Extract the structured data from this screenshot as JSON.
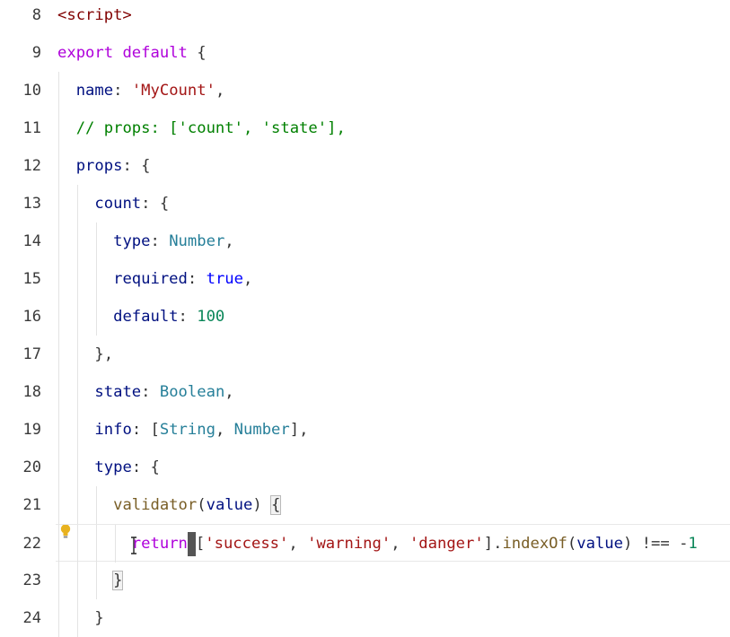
{
  "editor": {
    "lines": [
      {
        "num": "8",
        "tokens": [
          [
            "<script>",
            "tag"
          ]
        ]
      },
      {
        "num": "9",
        "tokens": [
          [
            "export",
            "kw"
          ],
          [
            " ",
            "punc"
          ],
          [
            "default",
            "kw"
          ],
          [
            " {",
            "punc"
          ]
        ]
      },
      {
        "num": "10",
        "tokens": [
          [
            "  ",
            "punc"
          ],
          [
            "name",
            "prop"
          ],
          [
            ": ",
            "punc"
          ],
          [
            "'MyCount'",
            "str"
          ],
          [
            ",",
            "punc"
          ]
        ]
      },
      {
        "num": "11",
        "tokens": [
          [
            "  ",
            "punc"
          ],
          [
            "// props: ['count', 'state'],",
            "cmt"
          ]
        ]
      },
      {
        "num": "12",
        "tokens": [
          [
            "  ",
            "punc"
          ],
          [
            "props",
            "prop"
          ],
          [
            ": {",
            "punc"
          ]
        ]
      },
      {
        "num": "13",
        "tokens": [
          [
            "    ",
            "punc"
          ],
          [
            "count",
            "prop"
          ],
          [
            ": {",
            "punc"
          ]
        ]
      },
      {
        "num": "14",
        "tokens": [
          [
            "      ",
            "punc"
          ],
          [
            "type",
            "prop"
          ],
          [
            ": ",
            "punc"
          ],
          [
            "Number",
            "type"
          ],
          [
            ",",
            "punc"
          ]
        ]
      },
      {
        "num": "15",
        "tokens": [
          [
            "      ",
            "punc"
          ],
          [
            "required",
            "prop"
          ],
          [
            ": ",
            "punc"
          ],
          [
            "true",
            "bool"
          ],
          [
            ",",
            "punc"
          ]
        ]
      },
      {
        "num": "16",
        "tokens": [
          [
            "      ",
            "punc"
          ],
          [
            "default",
            "prop"
          ],
          [
            ": ",
            "punc"
          ],
          [
            "100",
            "num"
          ]
        ]
      },
      {
        "num": "17",
        "tokens": [
          [
            "    ",
            "punc"
          ],
          [
            "},",
            "punc"
          ]
        ]
      },
      {
        "num": "18",
        "tokens": [
          [
            "    ",
            "punc"
          ],
          [
            "state",
            "prop"
          ],
          [
            ": ",
            "punc"
          ],
          [
            "Boolean",
            "type"
          ],
          [
            ",",
            "punc"
          ]
        ]
      },
      {
        "num": "19",
        "tokens": [
          [
            "    ",
            "punc"
          ],
          [
            "info",
            "prop"
          ],
          [
            ": [",
            "punc"
          ],
          [
            "String",
            "type"
          ],
          [
            ", ",
            "punc"
          ],
          [
            "Number",
            "type"
          ],
          [
            "],",
            "punc"
          ]
        ]
      },
      {
        "num": "20",
        "tokens": [
          [
            "    ",
            "punc"
          ],
          [
            "type",
            "prop"
          ],
          [
            ": {",
            "punc"
          ]
        ]
      },
      {
        "num": "21",
        "tokens": [
          [
            "      ",
            "punc"
          ],
          [
            "validator",
            "fn"
          ],
          [
            "(",
            "punc"
          ],
          [
            "value",
            "prop"
          ],
          [
            ") ",
            "punc"
          ],
          [
            "{",
            "bracket"
          ]
        ]
      },
      {
        "num": "22",
        "current": true,
        "tokens": [
          [
            "        ",
            "punc"
          ],
          [
            "return",
            "ctl"
          ],
          [
            "",
            "cursor"
          ],
          [
            "[",
            "punc"
          ],
          [
            "'success'",
            "str"
          ],
          [
            ", ",
            "punc"
          ],
          [
            "'warning'",
            "str"
          ],
          [
            ", ",
            "punc"
          ],
          [
            "'danger'",
            "str"
          ],
          [
            "].",
            "punc"
          ],
          [
            "indexOf",
            "fn"
          ],
          [
            "(",
            "punc"
          ],
          [
            "value",
            "prop"
          ],
          [
            ") !== -",
            "punc"
          ],
          [
            "1",
            "num"
          ]
        ]
      },
      {
        "num": "23",
        "tokens": [
          [
            "      ",
            "punc"
          ],
          [
            "}",
            "bracket"
          ]
        ]
      },
      {
        "num": "24",
        "tokens": [
          [
            "    ",
            "punc"
          ],
          [
            "}",
            "punc"
          ]
        ]
      }
    ],
    "guides": {
      "10": [
        1
      ],
      "11": [
        1
      ],
      "12": [
        1
      ],
      "13": [
        1,
        2
      ],
      "14": [
        1,
        2,
        3
      ],
      "15": [
        1,
        2,
        3
      ],
      "16": [
        1,
        2,
        3
      ],
      "17": [
        1,
        2
      ],
      "18": [
        1,
        2
      ],
      "19": [
        1,
        2
      ],
      "20": [
        1,
        2
      ],
      "21": [
        1,
        2,
        3
      ],
      "22": [
        1,
        2,
        3,
        4
      ],
      "23": [
        1,
        2,
        3
      ],
      "24": [
        1,
        2
      ]
    },
    "colors": {
      "tag": "#800000",
      "keyword": "#af00db",
      "property": "#001080",
      "string": "#a31515",
      "comment": "#008000",
      "type": "#267f99",
      "boolean": "#0000ff",
      "number": "#098658",
      "function": "#795e26"
    },
    "icons": [
      "lightbulb-icon",
      "text-cursor-icon"
    ]
  }
}
